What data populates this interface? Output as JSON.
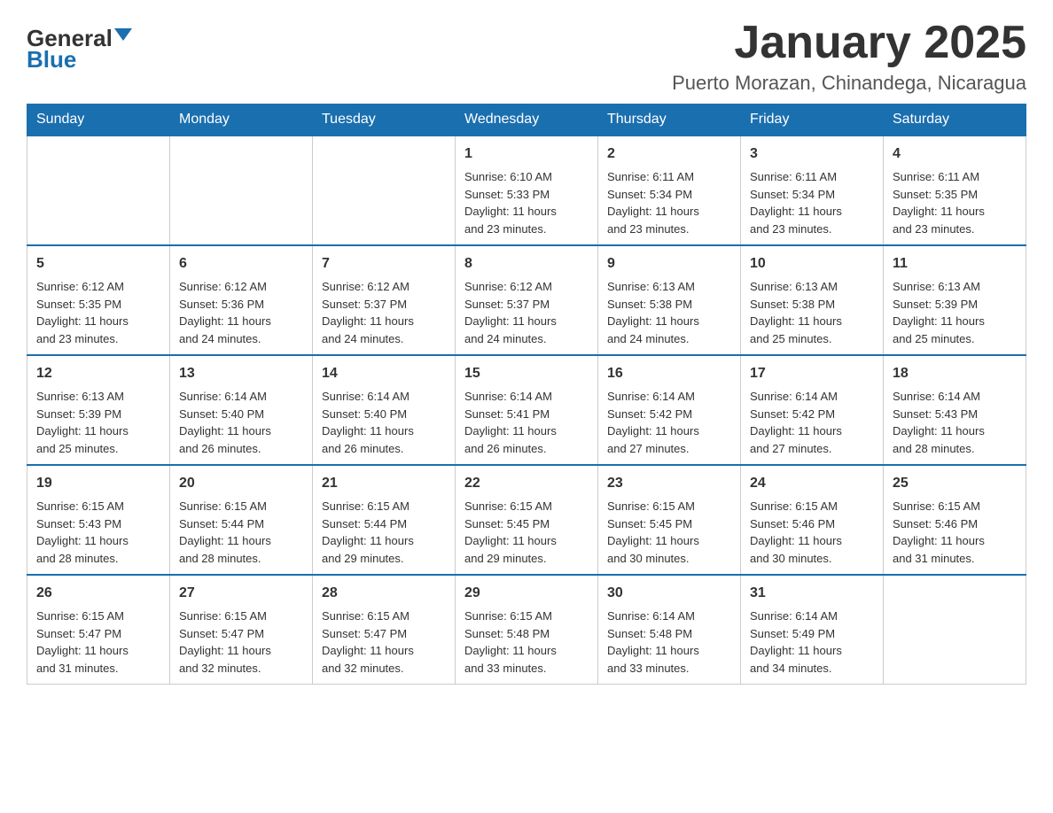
{
  "header": {
    "logo_general": "General",
    "logo_blue": "Blue",
    "title": "January 2025",
    "subtitle": "Puerto Morazan, Chinandega, Nicaragua"
  },
  "days_of_week": [
    "Sunday",
    "Monday",
    "Tuesday",
    "Wednesday",
    "Thursday",
    "Friday",
    "Saturday"
  ],
  "weeks": [
    [
      {
        "day": "",
        "info": ""
      },
      {
        "day": "",
        "info": ""
      },
      {
        "day": "",
        "info": ""
      },
      {
        "day": "1",
        "info": "Sunrise: 6:10 AM\nSunset: 5:33 PM\nDaylight: 11 hours\nand 23 minutes."
      },
      {
        "day": "2",
        "info": "Sunrise: 6:11 AM\nSunset: 5:34 PM\nDaylight: 11 hours\nand 23 minutes."
      },
      {
        "day": "3",
        "info": "Sunrise: 6:11 AM\nSunset: 5:34 PM\nDaylight: 11 hours\nand 23 minutes."
      },
      {
        "day": "4",
        "info": "Sunrise: 6:11 AM\nSunset: 5:35 PM\nDaylight: 11 hours\nand 23 minutes."
      }
    ],
    [
      {
        "day": "5",
        "info": "Sunrise: 6:12 AM\nSunset: 5:35 PM\nDaylight: 11 hours\nand 23 minutes."
      },
      {
        "day": "6",
        "info": "Sunrise: 6:12 AM\nSunset: 5:36 PM\nDaylight: 11 hours\nand 24 minutes."
      },
      {
        "day": "7",
        "info": "Sunrise: 6:12 AM\nSunset: 5:37 PM\nDaylight: 11 hours\nand 24 minutes."
      },
      {
        "day": "8",
        "info": "Sunrise: 6:12 AM\nSunset: 5:37 PM\nDaylight: 11 hours\nand 24 minutes."
      },
      {
        "day": "9",
        "info": "Sunrise: 6:13 AM\nSunset: 5:38 PM\nDaylight: 11 hours\nand 24 minutes."
      },
      {
        "day": "10",
        "info": "Sunrise: 6:13 AM\nSunset: 5:38 PM\nDaylight: 11 hours\nand 25 minutes."
      },
      {
        "day": "11",
        "info": "Sunrise: 6:13 AM\nSunset: 5:39 PM\nDaylight: 11 hours\nand 25 minutes."
      }
    ],
    [
      {
        "day": "12",
        "info": "Sunrise: 6:13 AM\nSunset: 5:39 PM\nDaylight: 11 hours\nand 25 minutes."
      },
      {
        "day": "13",
        "info": "Sunrise: 6:14 AM\nSunset: 5:40 PM\nDaylight: 11 hours\nand 26 minutes."
      },
      {
        "day": "14",
        "info": "Sunrise: 6:14 AM\nSunset: 5:40 PM\nDaylight: 11 hours\nand 26 minutes."
      },
      {
        "day": "15",
        "info": "Sunrise: 6:14 AM\nSunset: 5:41 PM\nDaylight: 11 hours\nand 26 minutes."
      },
      {
        "day": "16",
        "info": "Sunrise: 6:14 AM\nSunset: 5:42 PM\nDaylight: 11 hours\nand 27 minutes."
      },
      {
        "day": "17",
        "info": "Sunrise: 6:14 AM\nSunset: 5:42 PM\nDaylight: 11 hours\nand 27 minutes."
      },
      {
        "day": "18",
        "info": "Sunrise: 6:14 AM\nSunset: 5:43 PM\nDaylight: 11 hours\nand 28 minutes."
      }
    ],
    [
      {
        "day": "19",
        "info": "Sunrise: 6:15 AM\nSunset: 5:43 PM\nDaylight: 11 hours\nand 28 minutes."
      },
      {
        "day": "20",
        "info": "Sunrise: 6:15 AM\nSunset: 5:44 PM\nDaylight: 11 hours\nand 28 minutes."
      },
      {
        "day": "21",
        "info": "Sunrise: 6:15 AM\nSunset: 5:44 PM\nDaylight: 11 hours\nand 29 minutes."
      },
      {
        "day": "22",
        "info": "Sunrise: 6:15 AM\nSunset: 5:45 PM\nDaylight: 11 hours\nand 29 minutes."
      },
      {
        "day": "23",
        "info": "Sunrise: 6:15 AM\nSunset: 5:45 PM\nDaylight: 11 hours\nand 30 minutes."
      },
      {
        "day": "24",
        "info": "Sunrise: 6:15 AM\nSunset: 5:46 PM\nDaylight: 11 hours\nand 30 minutes."
      },
      {
        "day": "25",
        "info": "Sunrise: 6:15 AM\nSunset: 5:46 PM\nDaylight: 11 hours\nand 31 minutes."
      }
    ],
    [
      {
        "day": "26",
        "info": "Sunrise: 6:15 AM\nSunset: 5:47 PM\nDaylight: 11 hours\nand 31 minutes."
      },
      {
        "day": "27",
        "info": "Sunrise: 6:15 AM\nSunset: 5:47 PM\nDaylight: 11 hours\nand 32 minutes."
      },
      {
        "day": "28",
        "info": "Sunrise: 6:15 AM\nSunset: 5:47 PM\nDaylight: 11 hours\nand 32 minutes."
      },
      {
        "day": "29",
        "info": "Sunrise: 6:15 AM\nSunset: 5:48 PM\nDaylight: 11 hours\nand 33 minutes."
      },
      {
        "day": "30",
        "info": "Sunrise: 6:14 AM\nSunset: 5:48 PM\nDaylight: 11 hours\nand 33 minutes."
      },
      {
        "day": "31",
        "info": "Sunrise: 6:14 AM\nSunset: 5:49 PM\nDaylight: 11 hours\nand 34 minutes."
      },
      {
        "day": "",
        "info": ""
      }
    ]
  ]
}
